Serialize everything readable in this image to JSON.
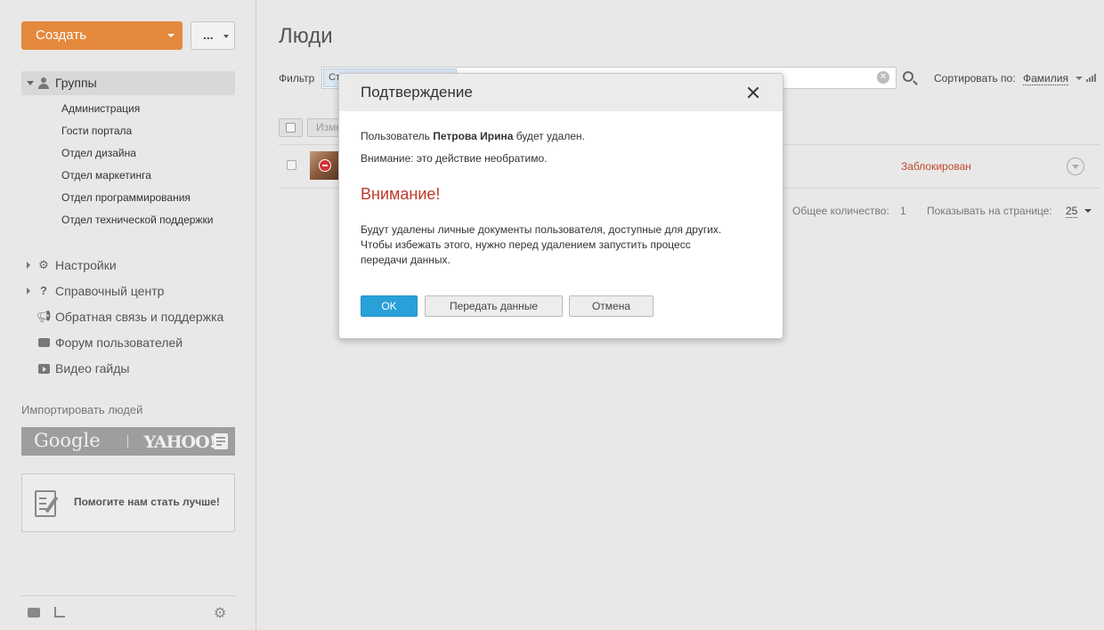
{
  "sidebar": {
    "create_label": "Создать",
    "more_label": "...",
    "groups_label": "Группы",
    "groups": [
      "Администрация",
      "Гости портала",
      "Отдел дизайна",
      "Отдел маркетинга",
      "Отдел программирования",
      "Отдел технической поддержки"
    ],
    "nav": [
      "Настройки",
      "Справочный центр",
      "Обратная связь и поддержка",
      "Форум пользователей",
      "Видео гайды"
    ],
    "import_title": "Импортировать людей",
    "import_google": "Google",
    "import_yahoo": "YAHOO!",
    "feedback_text": "Помогите нам стать лучше!"
  },
  "main": {
    "title": "Люди",
    "filter_label": "Фильтр",
    "filter_chip": "Ст",
    "sort_label": "Сортировать по:",
    "sort_value": "Фамилия",
    "edit_label": "Изме",
    "row_status": "Заблокирован",
    "total_label": "Общее количество:",
    "total_value": "1",
    "perpage_label": "Показывать на странице:",
    "perpage_value": "25"
  },
  "dialog": {
    "title": "Подтверждение",
    "line1_prefix": "Пользователь ",
    "line1_name": "Петрова Ирина",
    "line1_suffix": " будет удален.",
    "line2": "Внимание: это действие необратимо.",
    "warning": "Внимание!",
    "desc_1": "Будут удалены личные документы пользователя, доступные для других.",
    "desc_2": "Чтобы избежать этого, нужно перед удалением запустить процесс",
    "desc_3": "передачи данных.",
    "ok_label": "OK",
    "transfer_label": "Передать данные",
    "cancel_label": "Отмена"
  },
  "colors": {
    "accent_orange": "#e5893c",
    "primary_blue": "#2aa0d8",
    "warning_red": "#c0392b"
  }
}
